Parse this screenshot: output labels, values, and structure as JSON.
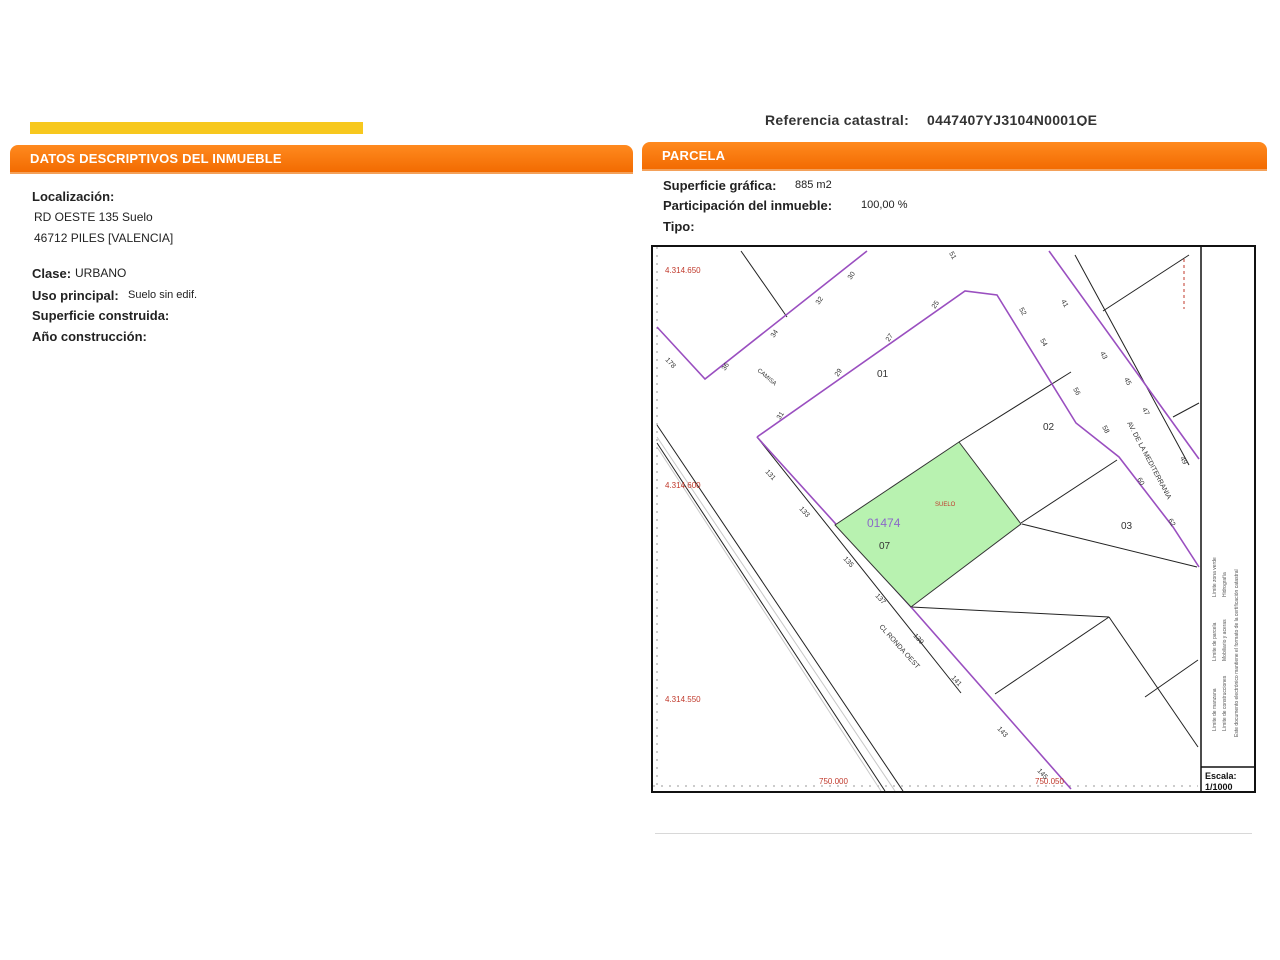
{
  "reference": {
    "label": "Referencia catastral:",
    "value": "0447407YJ3104N0001QE"
  },
  "descriptive": {
    "header": "DATOS DESCRIPTIVOS DEL INMUEBLE",
    "localizacion_label": "Localización:",
    "address_line1": "RD OESTE 135 Suelo",
    "address_line2": "46712 PILES [VALENCIA]",
    "clase_label": "Clase:",
    "clase_value": "URBANO",
    "uso_label": "Uso principal:",
    "uso_value": "Suelo sin edif.",
    "superficie_construida_label": "Superficie construida:",
    "anio_label": "Año construcción:"
  },
  "parcela": {
    "header": "PARCELA",
    "superficie_label": "Superficie gráfica:",
    "superficie_value": "885 m2",
    "participacion_label": "Participación del inmueble:",
    "participacion_value": "100,00 %",
    "tipo_label": "Tipo:"
  },
  "map": {
    "coord_top": "4.314.650",
    "coord_mid": "4.314.600",
    "coord_bot": "4.314.550",
    "coord_x1": "750.000",
    "coord_x2": "750.050",
    "parcel_number": "01474",
    "parcel_sub": "07",
    "parcel_tag": "SUELO",
    "lot_01": "01",
    "lot_02": "02",
    "lot_03": "03",
    "street_av": "AV. DE LA MEDITERRANIA",
    "street_rd": "CL RONDA OEST",
    "street_c": "CAMISA",
    "scale_label": "Escala:",
    "scale_value": "1/1000",
    "parcel_fill": "#b8f2b0",
    "boundary_color": "#9a4fc0",
    "coord_color": "#c0392b",
    "house_numbers": [
      "30",
      "32",
      "34",
      "36",
      "178",
      "25",
      "27",
      "29",
      "31",
      "131",
      "133",
      "135",
      "137",
      "139",
      "141",
      "143",
      "145",
      "41",
      "43",
      "45",
      "47",
      "49",
      "51",
      "52",
      "54",
      "56",
      "58",
      "60",
      "62"
    ],
    "legend": [
      "Límite de manzana",
      "Límite de parcela",
      "Límite de construcciones",
      "Mobiliario y aceras",
      "Límite zona verde",
      "Hidrografía"
    ],
    "legend_note": "Este documento electrónico mantiene el formato de la certificación catastral"
  }
}
